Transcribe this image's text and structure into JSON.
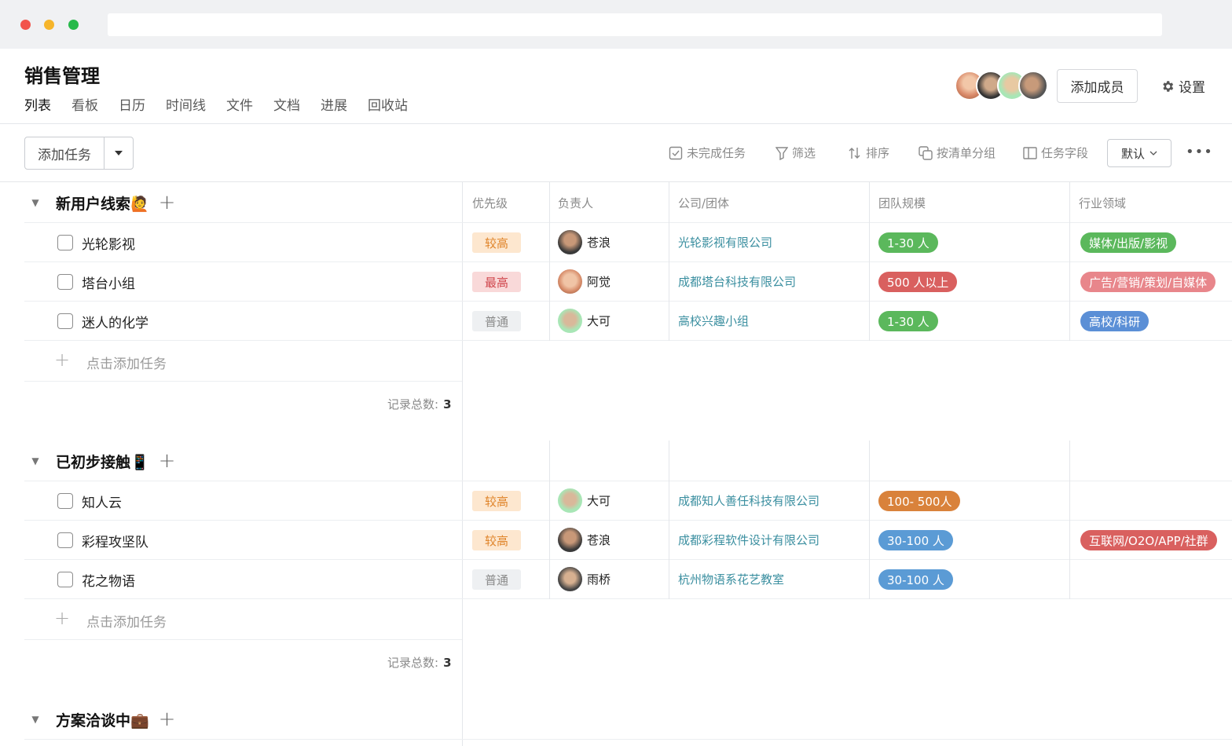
{
  "app": {
    "title": "销售管理",
    "tabs": [
      "列表",
      "看板",
      "日历",
      "时间线",
      "文件",
      "文档",
      "进展",
      "回收站"
    ],
    "add_member": "添加成员",
    "settings": "设置"
  },
  "toolbar": {
    "add_task": "添加任务",
    "incomplete": "未完成任务",
    "filter": "筛选",
    "sort": "排序",
    "group_by": "按清单分组",
    "fields": "任务字段",
    "view": "默认"
  },
  "columns": [
    "优先级",
    "负责人",
    "公司/团体",
    "团队规模",
    "行业领域"
  ],
  "add_task_row": "点击添加任务",
  "count_label": "记录总数:",
  "colors": {
    "link": "#3b8fa0",
    "green": "#5bb85c",
    "red": "#d9605f",
    "blue": "#5b9bd5",
    "orange": "#d9823b",
    "pink": "#e8868b"
  },
  "groups": [
    {
      "name": "新用户线索🙋",
      "count": "3",
      "rows": [
        {
          "task": "光轮影视",
          "priority": "较高",
          "prio_class": "p-high",
          "owner": "苍浪",
          "company": "光轮影视有限公司",
          "size": "1-30 人",
          "size_color": "#5bb85c",
          "industry": "媒体/出版/影视",
          "industry_color": "#5bb85c"
        },
        {
          "task": "塔台小组",
          "priority": "最高",
          "prio_class": "p-top",
          "owner": "阿觉",
          "company": "成都塔台科技有限公司",
          "size": "500 人以上",
          "size_color": "#d9605f",
          "industry": "广告/营销/策划/自媒体",
          "industry_color": "#e8868b"
        },
        {
          "task": "迷人的化学",
          "priority": "普通",
          "prio_class": "p-norm",
          "owner": "大可",
          "company": "高校兴趣小组",
          "size": "1-30 人",
          "size_color": "#5bb85c",
          "industry": "高校/科研",
          "industry_color": "#5b8fd6"
        }
      ]
    },
    {
      "name": "已初步接触📱",
      "count": "3",
      "rows": [
        {
          "task": "知人云",
          "priority": "较高",
          "prio_class": "p-high",
          "owner": "大可",
          "company": "成都知人善任科技有限公司",
          "size": "100- 500人",
          "size_color": "#d9823b",
          "industry": "",
          "industry_color": ""
        },
        {
          "task": "彩程攻坚队",
          "priority": "较高",
          "prio_class": "p-high",
          "owner": "苍浪",
          "company": "成都彩程软件设计有限公司",
          "size": "30-100 人",
          "size_color": "#5b9bd5",
          "industry": "互联网/O2O/APP/社群",
          "industry_color": "#d9605f"
        },
        {
          "task": "花之物语",
          "priority": "普通",
          "prio_class": "p-norm",
          "owner": "雨桥",
          "company": "杭州物语系花艺教室",
          "size": "30-100 人",
          "size_color": "#5b9bd5",
          "industry": "",
          "industry_color": ""
        }
      ]
    },
    {
      "name": "方案洽谈中💼",
      "count": "",
      "rows": []
    }
  ]
}
